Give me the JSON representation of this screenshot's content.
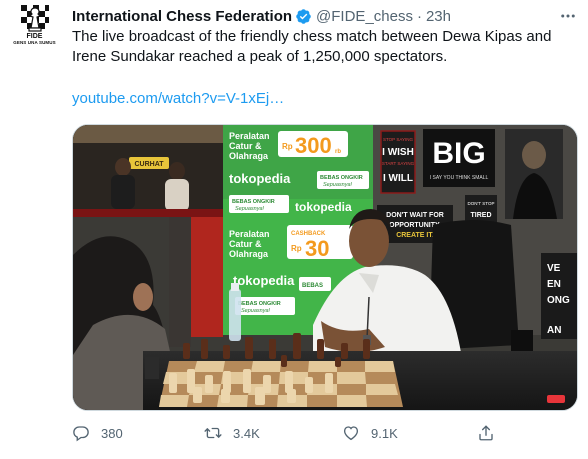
{
  "tweet": {
    "author_name": "International Chess Federation",
    "handle": "@FIDE_chess",
    "separator": "·",
    "time": "23h",
    "text": "The live broadcast of the friendly chess match between Dewa Kipas and Irene Sundakar reached a peak of 1,250,000 spectators.",
    "link": "youtube.com/watch?v=V-1xEj…"
  },
  "avatar": {
    "org": "FIDE",
    "motto": "GENS UNA SUMUS"
  },
  "media": {
    "signs": {
      "tokopedia_1": "tokopedia",
      "tokopedia_2": "tokopedia",
      "tokopedia_3": "tokopedia",
      "peralatan_1": "Peralatan",
      "catur_1": "Catur &",
      "olahraga_1": "Olahraga",
      "rp_1": "Rp",
      "price_1": "300",
      "rb": "rb",
      "peralatan_2": "Peralatan",
      "catur_2": "Catur &",
      "olahraga_2": "Olahraga",
      "cashback": "CASHBACK",
      "rp_2": "Rp",
      "price_2": "30",
      "bebas_1": "BEBAS ONGKIR",
      "sepuasnya_1": "Sepuasnya!",
      "bebas_2": "BEBAS ONGKIR",
      "sepuasnya_2": "Sepuasnya!",
      "bebas_3": "BEBAS",
      "bebas_4": "BEBAS ONGKIR",
      "sepuasnya_4": "Sepuasnya!",
      "poster_big": "BIG",
      "poster_big_sub": "I SAY YOU THINK SMALL",
      "poster_wish_1": "STOP SAYING",
      "poster_wish_2": "I WISH",
      "poster_wish_3": "START SAYING",
      "poster_wish_4": "I WILL",
      "poster_wait_1": "DON'T WAIT FOR",
      "poster_wait_2": "OPPORTUNITY.",
      "poster_wait_3": "CREATE IT.",
      "poster_stop_1": "DON'T STOP",
      "poster_stop_2": "TIRED",
      "poster_right_1": "VE",
      "poster_right_2": "EN",
      "poster_right_3": "ONG",
      "poster_right_4": "AN",
      "studio_sign": "CURHAT"
    }
  },
  "actions": {
    "replies": "380",
    "retweets": "3.4K",
    "likes": "9.1K"
  },
  "colors": {
    "link": "#1d9bf0",
    "secondary_text": "#536471",
    "verified": "#1d9bf0",
    "tokopedia_green": "#42b549",
    "promo_orange": "#f3a525"
  }
}
